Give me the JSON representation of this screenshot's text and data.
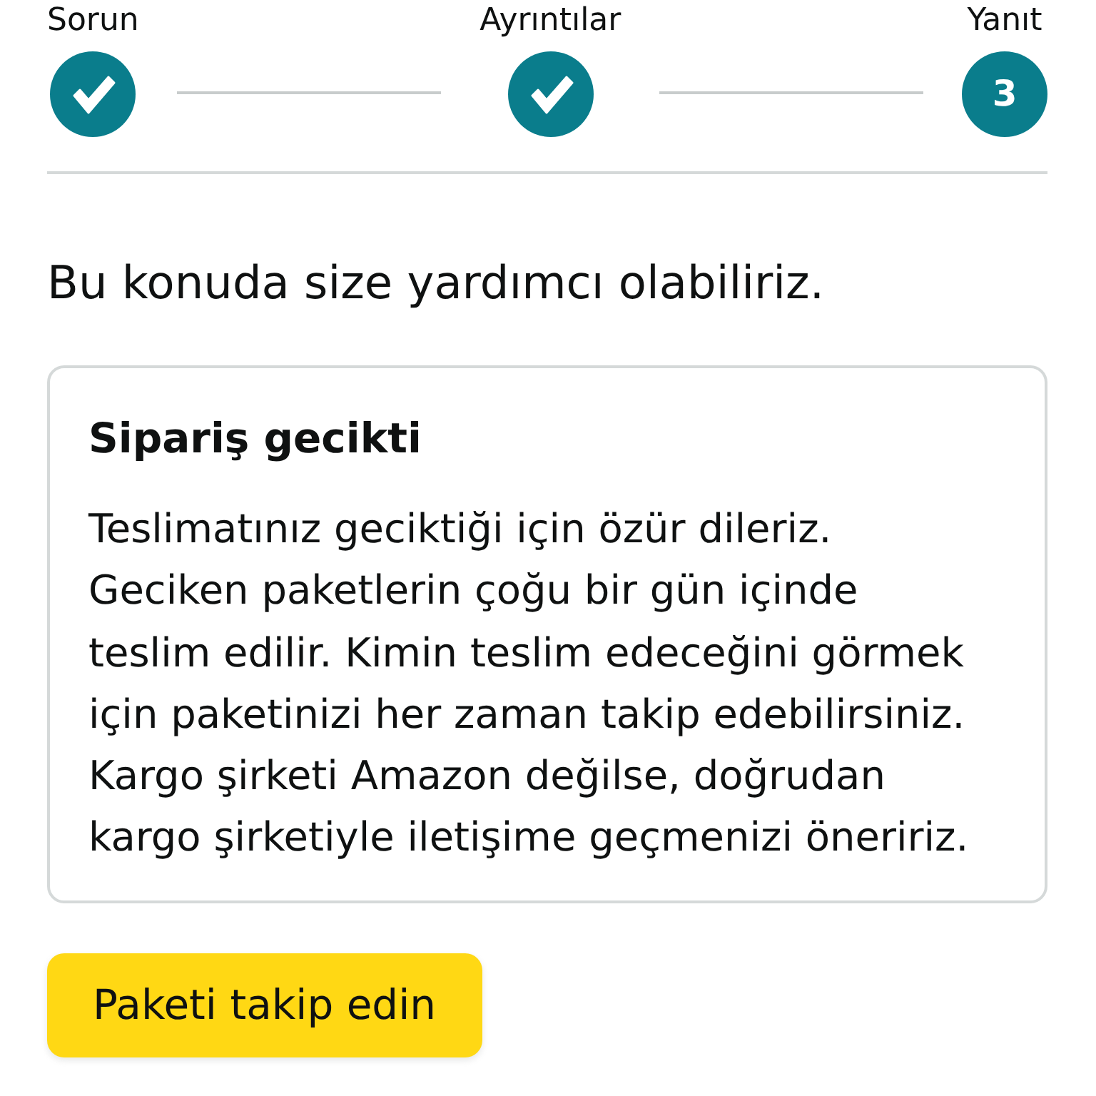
{
  "steps": [
    {
      "label": "Sorun",
      "completed": true
    },
    {
      "label": "Ayrıntılar",
      "completed": true
    },
    {
      "label": "Yanıt",
      "completed": false,
      "number": "3"
    }
  ],
  "heading": "Bu konuda size yardımcı olabiliriz.",
  "card": {
    "title": "Sipariş gecikti",
    "body": "Teslimatınız geciktiği için özür dileriz. Geciken paketlerin çoğu bir gün içinde teslim edilir. Kimin teslim edeceğini görmek için paketinizi her zaman takip edebilirsiniz. Kargo şirketi Amazon değilse, doğrudan kargo şirketiyle iletişime geçmenizi öneririz."
  },
  "button": {
    "label": "Paketi takip edin"
  }
}
